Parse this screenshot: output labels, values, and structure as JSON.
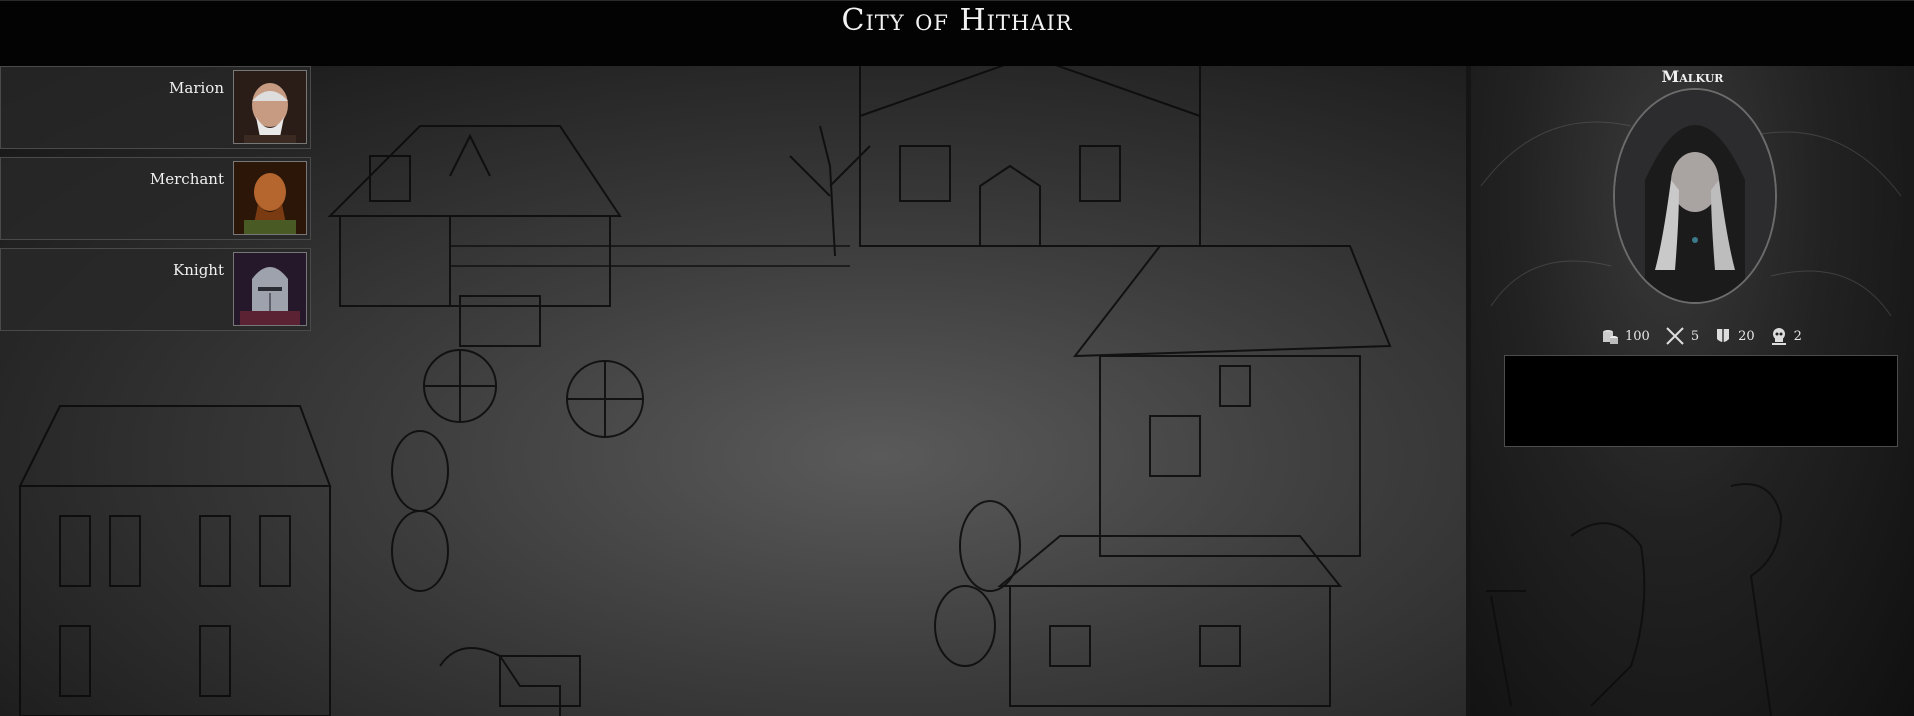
{
  "header": {
    "title": "City of Hithair"
  },
  "npcs": [
    {
      "name": "Marion",
      "portrait_icon": "old-man-portrait"
    },
    {
      "name": "Merchant",
      "portrait_icon": "merchant-portrait"
    },
    {
      "name": "Knight",
      "portrait_icon": "knight-helmet-portrait"
    }
  ],
  "hero": {
    "name": "Malkur",
    "portrait_icon": "hooded-woman-portrait",
    "stats": [
      {
        "icon": "gold-coins-icon",
        "value": "100"
      },
      {
        "icon": "crossed-swords-icon",
        "value": "5"
      },
      {
        "icon": "armor-icon",
        "value": "20"
      },
      {
        "icon": "skull-icon",
        "value": "2"
      }
    ]
  },
  "colors": {
    "background": "#000000",
    "panel": "#282828",
    "text": "#f0f0f0"
  }
}
